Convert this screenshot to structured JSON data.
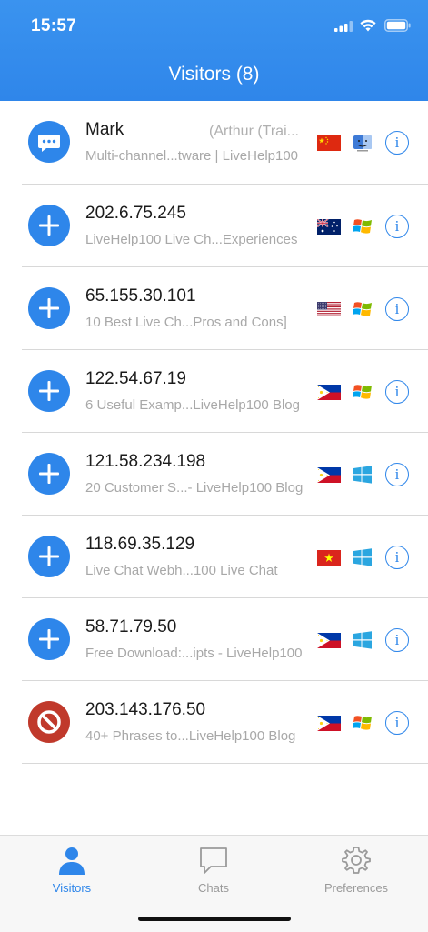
{
  "status_bar": {
    "time": "15:57"
  },
  "header": {
    "title": "Visitors (8)"
  },
  "colors": {
    "accent": "#2e86ea",
    "blocked": "#c0392b"
  },
  "visitors": [
    {
      "name": "Mark",
      "extra": "(Arthur (Trai...",
      "subtitle": "Multi-channel...tware | LiveHelp100",
      "avatar_icon": "chat-bubble-icon",
      "flag": "china",
      "os": "mac"
    },
    {
      "name": "202.6.75.245",
      "extra": "",
      "subtitle": "LiveHelp100 Live Ch...Experiences",
      "avatar_icon": "plus-icon",
      "flag": "australia",
      "os": "windows-xp"
    },
    {
      "name": "65.155.30.101",
      "extra": "",
      "subtitle": "10 Best Live Ch...Pros and Cons]",
      "avatar_icon": "plus-icon",
      "flag": "usa",
      "os": "windows-xp"
    },
    {
      "name": "122.54.67.19",
      "extra": "",
      "subtitle": "6 Useful Examp...LiveHelp100 Blog",
      "avatar_icon": "plus-icon",
      "flag": "philippines",
      "os": "windows-xp"
    },
    {
      "name": "121.58.234.198",
      "extra": "",
      "subtitle": "20 Customer S...- LiveHelp100 Blog",
      "avatar_icon": "plus-icon",
      "flag": "philippines",
      "os": "windows-10"
    },
    {
      "name": "118.69.35.129",
      "extra": "",
      "subtitle": "Live Chat Webh...100 Live Chat",
      "avatar_icon": "plus-icon",
      "flag": "vietnam",
      "os": "windows-10"
    },
    {
      "name": "58.71.79.50",
      "extra": "",
      "subtitle": "Free Download:...ipts - LiveHelp100",
      "avatar_icon": "plus-icon",
      "flag": "philippines",
      "os": "windows-10"
    },
    {
      "name": "203.143.176.50",
      "extra": "",
      "subtitle": "40+ Phrases to...LiveHelp100 Blog",
      "avatar_icon": "blocked-icon",
      "flag": "philippines",
      "os": "windows-xp"
    }
  ],
  "tabs": [
    {
      "label": "Visitors",
      "icon": "person-icon",
      "active": true
    },
    {
      "label": "Chats",
      "icon": "chat-icon",
      "active": false
    },
    {
      "label": "Preferences",
      "icon": "gear-icon",
      "active": false
    }
  ]
}
